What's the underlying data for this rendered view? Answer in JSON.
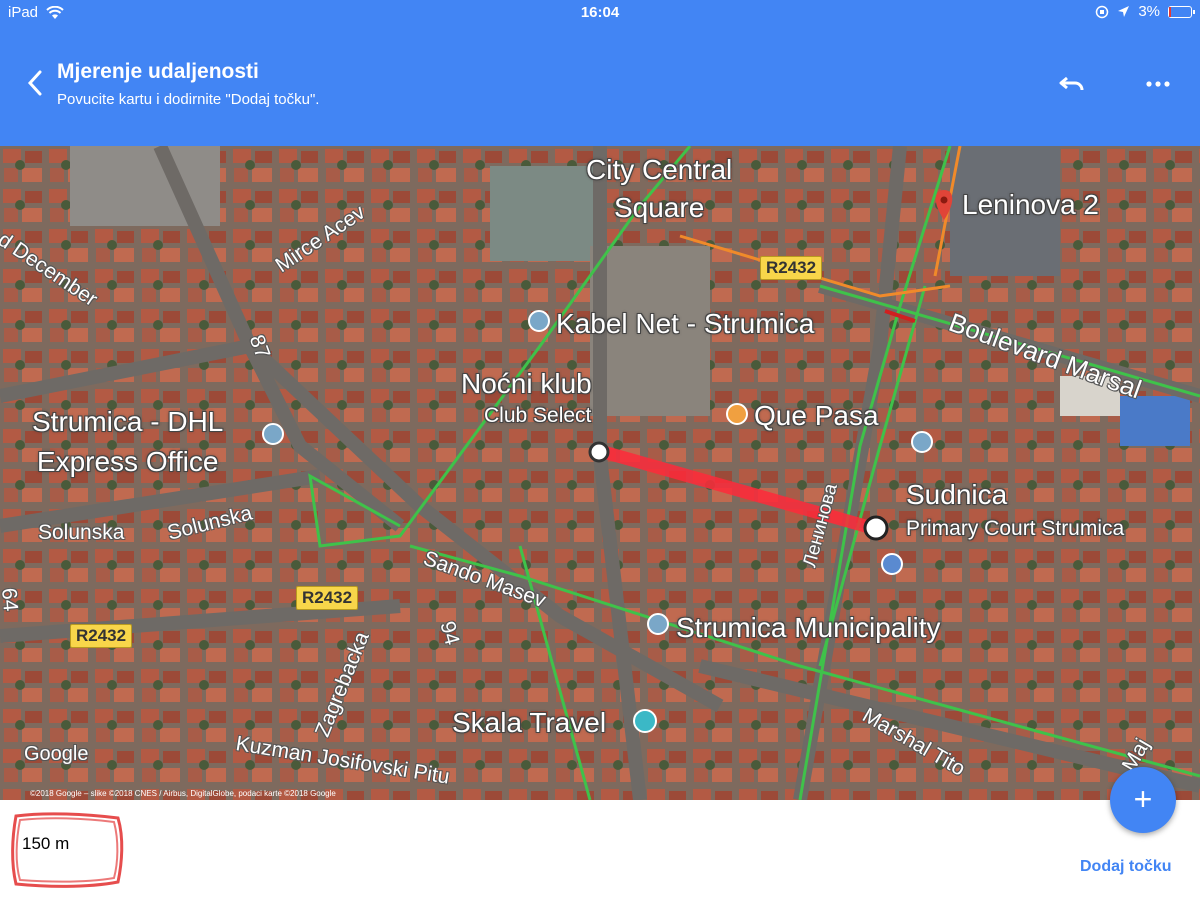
{
  "status_bar": {
    "device": "iPad",
    "time": "16:04",
    "battery": "3%"
  },
  "app_bar": {
    "title": "Mjerenje udaljenosti",
    "subtitle": "Povucite kartu i dodirnite \"Dodaj točku\"."
  },
  "map": {
    "place_labels": {
      "city_square": "City Central\nSquare",
      "leninova": "Leninova 2",
      "kabel": "Kabel Net - Strumica",
      "nocni": "Noćni klub",
      "club_select": "Club Select",
      "que_pasa": "Que Pasa",
      "dhl": "Strumica - DHL\nExpress Office",
      "sudnica": "Sudnica",
      "court": "Primary Court Strumica",
      "municipality": "Strumica Municipality",
      "skala": "Skala Travel"
    },
    "road_labels": {
      "december": "d December",
      "mirce": "Mirce Acev",
      "boulevard": "Boulevard Marsal",
      "n87": "87",
      "solunska1": "Solunska",
      "solunska2": "Solunska",
      "sando": "Sando Masev",
      "leninova_cyr": "Ленинова",
      "n64": "64",
      "n94": "94",
      "zagrebacka": "Zagrebacka",
      "kuzman": "Kuzman Josifovski Pitu",
      "marshal": "Marshal Tito",
      "maj": "Maj"
    },
    "shields": [
      "R2432",
      "R2432",
      "R2432"
    ],
    "google": "Google",
    "attribution": "©2018 Google – slike ©2018 CNES / Airbus, DigitalGlobe, podaci karte ©2018 Google"
  },
  "bottom": {
    "distance": "150 m",
    "add_point": "Dodaj točku",
    "fab_symbol": "+"
  },
  "colors": {
    "accent": "#4285f4",
    "measure_line": "#ff2a3a"
  }
}
